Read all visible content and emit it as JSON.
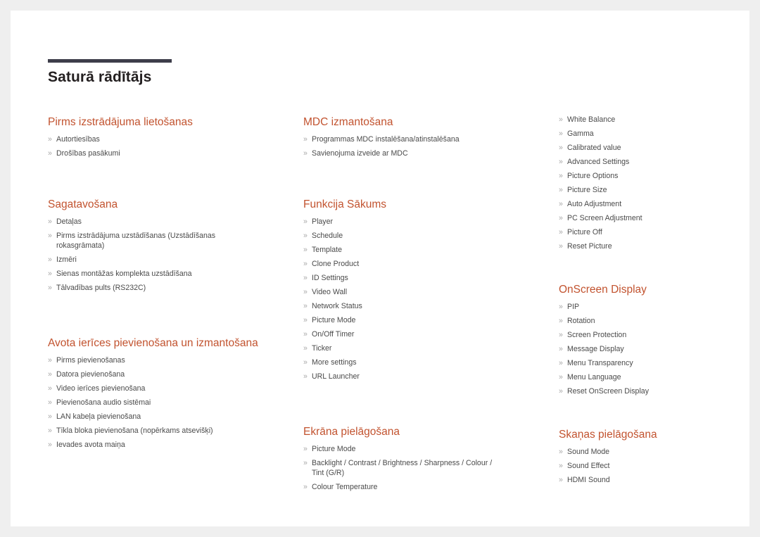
{
  "document": {
    "title": "Saturā rādītājs",
    "accent_color": "#c2532f",
    "title_color": "#231f20",
    "rule_color": "#3e3e4a",
    "text_color": "#4a4a4a",
    "bullet_color": "#a9a9a9",
    "bullet_glyph": "»",
    "page_background": "#ffffff",
    "canvas_background": "#efefef"
  },
  "columns": [
    {
      "id": "column-left",
      "sections": [
        {
          "heading": "Pirms izstrādājuma lietošanas",
          "items": [
            "Autortiesības",
            "Drošības pasākumi"
          ]
        },
        {
          "heading": "Sagatavošana",
          "items": [
            "Detaļas",
            "Pirms izstrādājuma uzstādīšanas (Uzstādīšanas rokasgrāmata)",
            "Izmēri",
            "Sienas montāžas komplekta uzstādīšana",
            "Tālvadības pults (RS232C)"
          ]
        },
        {
          "heading": "Avota ierīces pievienošana un izmantošana",
          "items": [
            "Pirms pievienošanas",
            "Datora pievienošana",
            "Video ierīces pievienošana",
            "Pievienošana audio sistēmai",
            "LAN kabeļa pievienošana",
            "Tīkla bloka pievienošana (nopērkams atsevišķi)",
            "Ievades avota maiņa"
          ]
        }
      ]
    },
    {
      "id": "column-middle",
      "sections": [
        {
          "heading": "MDC izmantošana",
          "items": [
            "Programmas MDC instalēšana/atinstalēšana",
            "Savienojuma izveide ar MDC"
          ]
        },
        {
          "heading": "Funkcija Sākums",
          "items": [
            "Player",
            "Schedule",
            "Template",
            "Clone Product",
            "ID Settings",
            "Video Wall",
            "Network Status",
            "Picture Mode",
            "On/Off Timer",
            "Ticker",
            "More settings",
            "URL Launcher"
          ]
        },
        {
          "heading": "Ekrāna pielāgošana",
          "items": [
            "Picture Mode",
            "Backlight / Contrast / Brightness / Sharpness / Colour / Tint (G/R)",
            "Colour Temperature"
          ]
        }
      ]
    },
    {
      "id": "column-right",
      "sections": [
        {
          "heading": "",
          "items": [
            "White Balance",
            "Gamma",
            "Calibrated value",
            "Advanced Settings",
            "Picture Options",
            "Picture Size",
            "Auto Adjustment",
            "PC Screen Adjustment",
            "Picture Off",
            "Reset Picture"
          ]
        },
        {
          "heading": "OnScreen Display",
          "items": [
            "PIP",
            "Rotation",
            "Screen Protection",
            "Message Display",
            "Menu Transparency",
            "Menu Language",
            "Reset OnScreen Display"
          ]
        },
        {
          "heading": "Skaņas pielāgošana",
          "items": [
            "Sound Mode",
            "Sound Effect",
            "HDMI Sound"
          ]
        }
      ]
    }
  ]
}
